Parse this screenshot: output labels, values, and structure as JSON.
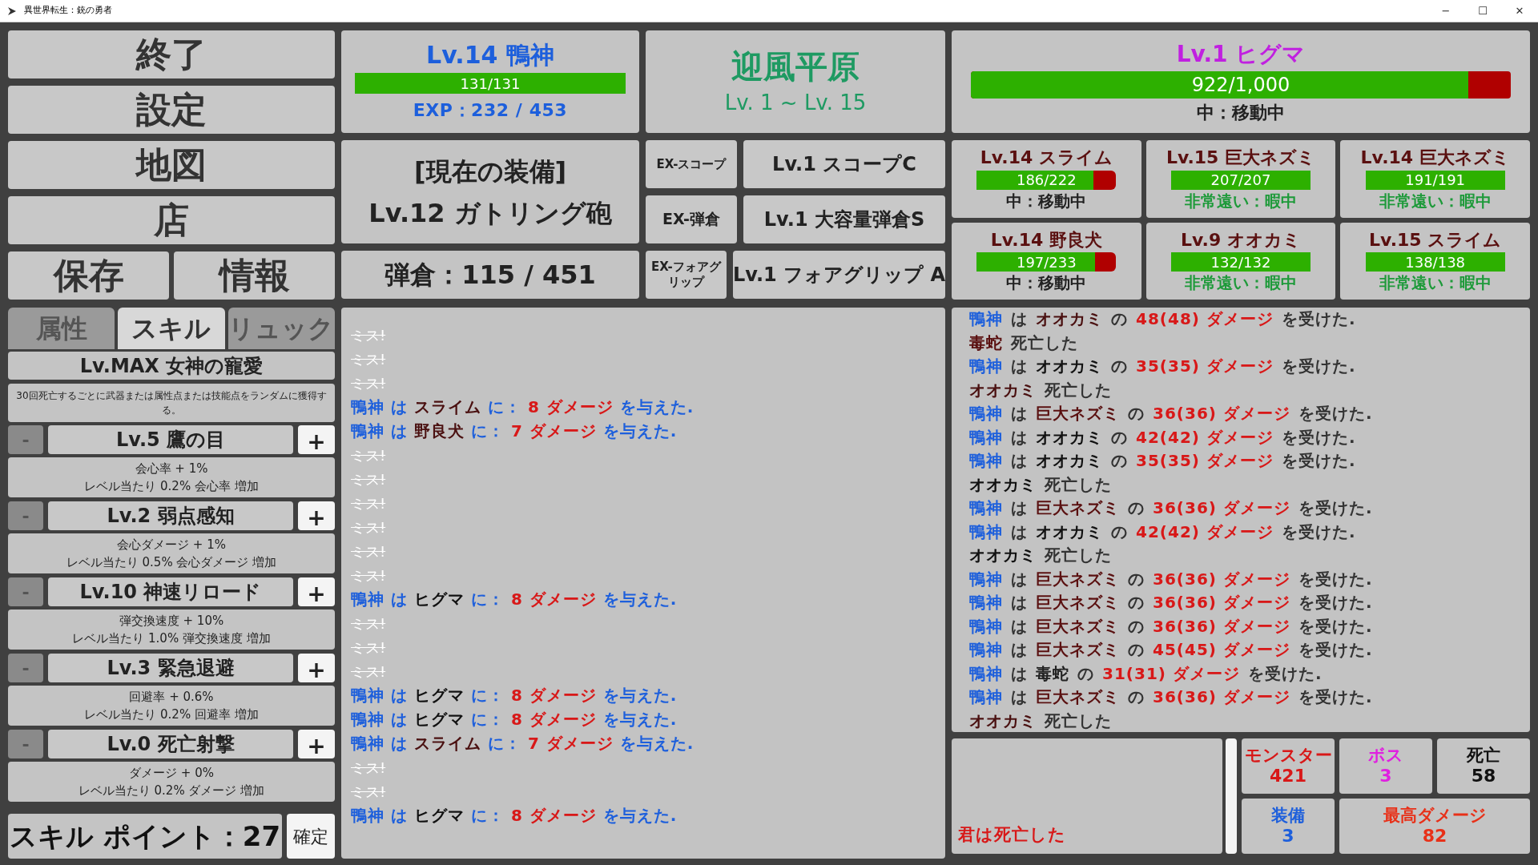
{
  "window": {
    "title": "異世界転生：銃の勇者",
    "controls": [
      "−",
      "☐",
      "✕"
    ]
  },
  "menu": {
    "top": [
      "終了",
      "設定",
      "地図",
      "店"
    ],
    "bottom": [
      "保存",
      "情報"
    ]
  },
  "player": {
    "name": "Lv.14 鴨神",
    "hp": "131/131",
    "level": 1,
    "exp": "EXP：232 / 453"
  },
  "equipment": {
    "heading": "[現在の装備]",
    "weapon": "Lv.12 ガトリング砲",
    "ammo": "弾倉：115 / 451",
    "slots": [
      {
        "slot": "EX-スコープ",
        "item": "Lv.1 スコープC"
      },
      {
        "slot": "EX-弾倉",
        "item": "Lv.1 大容量弾倉S"
      },
      {
        "slot": "EX-フォアグリップ",
        "item": "Lv.1 フォアグリップ A"
      }
    ]
  },
  "area": {
    "name": "迎風平原",
    "range": "Lv. 1 ~ Lv. 15"
  },
  "boss": {
    "name": "Lv.1 ヒグマ",
    "hp": "922/1,000",
    "level": 0.922,
    "status": "中：移動中",
    "kind": "near"
  },
  "monsters": [
    {
      "name": "Lv.14 スライム",
      "hp": "186/222",
      "level": 0.84,
      "status": "中：移動中",
      "kind": "near"
    },
    {
      "name": "Lv.15 巨大ネズミ",
      "hp": "207/207",
      "level": 1,
      "status": "非常遠い：暇中",
      "kind": "far"
    },
    {
      "name": "Lv.14 巨大ネズミ",
      "hp": "191/191",
      "level": 1,
      "status": "非常遠い：暇中",
      "kind": "far"
    },
    {
      "name": "Lv.14 野良犬",
      "hp": "197/233",
      "level": 0.85,
      "status": "中：移動中",
      "kind": "near"
    },
    {
      "name": "Lv.9 オオカミ",
      "hp": "132/132",
      "level": 1,
      "status": "非常遠い：暇中",
      "kind": "far"
    },
    {
      "name": "Lv.15 スライム",
      "hp": "138/138",
      "level": 1,
      "status": "非常遠い：暇中",
      "kind": "far"
    }
  ],
  "tabs": [
    {
      "label": "属性",
      "selected": false
    },
    {
      "label": "スキル",
      "selected": true
    },
    {
      "label": "リュック",
      "selected": false
    }
  ],
  "passive": {
    "name": "Lv.MAX 女神の寵愛",
    "description": "30回死亡するごとに武器または属性点または技能点をランダムに獲得する。"
  },
  "skills": [
    {
      "name": "Lv.5 鷹の目",
      "effect": "会心率 + 1%",
      "per_level": "レベル当たり 0.2% 会心率 増加"
    },
    {
      "name": "Lv.2 弱点感知",
      "effect": "会心ダメージ + 1%",
      "per_level": "レベル当たり 0.5% 会心ダメージ 増加"
    },
    {
      "name": "Lv.10 神速リロード",
      "effect": "弾交換速度 + 10%",
      "per_level": "レベル当たり 1.0% 弾交換速度 増加"
    },
    {
      "name": "Lv.3 緊急退避",
      "effect": "回避率 + 0.6%",
      "per_level": "レベル当たり 0.2% 回避率 増加"
    },
    {
      "name": "Lv.0 死亡射撃",
      "effect": "ダメージ + 0%",
      "per_level": "レベル当たり 0.2% ダメージ 増加"
    }
  ],
  "skill_buttons": {
    "minus": "-",
    "plus": "+"
  },
  "skill_points": {
    "label": "スキル ポイント：27",
    "confirm": "確定"
  },
  "attack_log": [
    {
      "kind": "miss",
      "text": "ミス!"
    },
    {
      "kind": "miss",
      "text": "ミス!"
    },
    {
      "kind": "miss",
      "text": "ミス!"
    },
    {
      "kind": "hit",
      "parts": [
        {
          "text": "鴨神 は",
          "color": "#1d5fdc"
        },
        {
          "text": "スライム",
          "color": "#4a1010"
        },
        {
          "text": "に：",
          "color": "#1d5fdc"
        },
        {
          "text": "8 ダメージ",
          "color": "#d81818"
        },
        {
          "text": "を与えた.",
          "color": "#1d5fdc"
        }
      ]
    },
    {
      "kind": "hit",
      "parts": [
        {
          "text": "鴨神 は",
          "color": "#1d5fdc"
        },
        {
          "text": "野良犬",
          "color": "#4a1010"
        },
        {
          "text": "に：",
          "color": "#1d5fdc"
        },
        {
          "text": "7 ダメージ",
          "color": "#d81818"
        },
        {
          "text": "を与えた.",
          "color": "#1d5fdc"
        }
      ]
    },
    {
      "kind": "miss",
      "text": "ミス!"
    },
    {
      "kind": "miss",
      "text": "ミス!"
    },
    {
      "kind": "miss",
      "text": "ミス!"
    },
    {
      "kind": "miss",
      "text": "ミス!"
    },
    {
      "kind": "miss",
      "text": "ミス!"
    },
    {
      "kind": "miss",
      "text": "ミス!"
    },
    {
      "kind": "hit",
      "parts": [
        {
          "text": "鴨神 は",
          "color": "#1d5fdc"
        },
        {
          "text": "ヒグマ",
          "color": "#111111"
        },
        {
          "text": "に：",
          "color": "#1d5fdc"
        },
        {
          "text": "8 ダメージ",
          "color": "#d81818"
        },
        {
          "text": "を与えた.",
          "color": "#1d5fdc"
        }
      ]
    },
    {
      "kind": "miss",
      "text": "ミス!"
    },
    {
      "kind": "miss",
      "text": "ミス!"
    },
    {
      "kind": "miss",
      "text": "ミス!"
    },
    {
      "kind": "hit",
      "parts": [
        {
          "text": "鴨神 は",
          "color": "#1d5fdc"
        },
        {
          "text": "ヒグマ",
          "color": "#111111"
        },
        {
          "text": "に：",
          "color": "#1d5fdc"
        },
        {
          "text": "8 ダメージ",
          "color": "#d81818"
        },
        {
          "text": "を与えた.",
          "color": "#1d5fdc"
        }
      ]
    },
    {
      "kind": "hit",
      "parts": [
        {
          "text": "鴨神 は",
          "color": "#1d5fdc"
        },
        {
          "text": "ヒグマ",
          "color": "#111111"
        },
        {
          "text": "に：",
          "color": "#1d5fdc"
        },
        {
          "text": "8 ダメージ",
          "color": "#d81818"
        },
        {
          "text": "を与えた.",
          "color": "#1d5fdc"
        }
      ]
    },
    {
      "kind": "hit",
      "parts": [
        {
          "text": "鴨神 は",
          "color": "#1d5fdc"
        },
        {
          "text": "スライム",
          "color": "#4a1010"
        },
        {
          "text": "に：",
          "color": "#1d5fdc"
        },
        {
          "text": "7 ダメージ",
          "color": "#d81818"
        },
        {
          "text": "を与えた.",
          "color": "#1d5fdc"
        }
      ]
    },
    {
      "kind": "miss",
      "text": "ミス!"
    },
    {
      "kind": "miss",
      "text": "ミス!"
    },
    {
      "kind": "hit",
      "parts": [
        {
          "text": "鴨神 は",
          "color": "#1d5fdc"
        },
        {
          "text": "ヒグマ",
          "color": "#111111"
        },
        {
          "text": "に：",
          "color": "#1d5fdc"
        },
        {
          "text": "8 ダメージ",
          "color": "#d81818"
        },
        {
          "text": "を与えた.",
          "color": "#1d5fdc"
        }
      ]
    }
  ],
  "damage_log": [
    {
      "parts": [
        {
          "text": "鴨神",
          "color": "#1d5fdc"
        },
        {
          "text": "は",
          "color": "#333333"
        },
        {
          "text": "オオカミ",
          "color": "#4a1010"
        },
        {
          "text": "の",
          "color": "#333333"
        },
        {
          "text": "48(48) ダメージ",
          "color": "#d81818"
        },
        {
          "text": "を受けた.",
          "color": "#333333"
        }
      ]
    },
    {
      "parts": [
        {
          "text": "毒蛇",
          "color": "#5a1010"
        },
        {
          "text": "死亡した",
          "color": "#333333"
        }
      ]
    },
    {
      "parts": [
        {
          "text": "鴨神",
          "color": "#1d5fdc"
        },
        {
          "text": "は",
          "color": "#333333"
        },
        {
          "text": "オオカミ",
          "color": "#111111"
        },
        {
          "text": "の",
          "color": "#333333"
        },
        {
          "text": "35(35) ダメージ",
          "color": "#d81818"
        },
        {
          "text": "を受けた.",
          "color": "#333333"
        }
      ]
    },
    {
      "parts": [
        {
          "text": "オオカミ",
          "color": "#4a1010"
        },
        {
          "text": "死亡した",
          "color": "#333333"
        }
      ]
    },
    {
      "parts": [
        {
          "text": "鴨神",
          "color": "#1d5fdc"
        },
        {
          "text": "は",
          "color": "#333333"
        },
        {
          "text": "巨大ネズミ",
          "color": "#5a1010"
        },
        {
          "text": "の",
          "color": "#333333"
        },
        {
          "text": "36(36) ダメージ",
          "color": "#d81818"
        },
        {
          "text": "を受けた.",
          "color": "#333333"
        }
      ]
    },
    {
      "parts": [
        {
          "text": "鴨神",
          "color": "#1d5fdc"
        },
        {
          "text": "は",
          "color": "#333333"
        },
        {
          "text": "オオカミ",
          "color": "#111111"
        },
        {
          "text": "の",
          "color": "#333333"
        },
        {
          "text": "42(42) ダメージ",
          "color": "#d81818"
        },
        {
          "text": "を受けた.",
          "color": "#333333"
        }
      ]
    },
    {
      "parts": [
        {
          "text": "鴨神",
          "color": "#1d5fdc"
        },
        {
          "text": "は",
          "color": "#333333"
        },
        {
          "text": "オオカミ",
          "color": "#111111"
        },
        {
          "text": "の",
          "color": "#333333"
        },
        {
          "text": "35(35) ダメージ",
          "color": "#d81818"
        },
        {
          "text": "を受けた.",
          "color": "#333333"
        }
      ]
    },
    {
      "parts": [
        {
          "text": "オオカミ",
          "color": "#111111"
        },
        {
          "text": "死亡した",
          "color": "#333333"
        }
      ]
    },
    {
      "parts": [
        {
          "text": "鴨神",
          "color": "#1d5fdc"
        },
        {
          "text": "は",
          "color": "#333333"
        },
        {
          "text": "巨大ネズミ",
          "color": "#5a1010"
        },
        {
          "text": "の",
          "color": "#333333"
        },
        {
          "text": "36(36) ダメージ",
          "color": "#d81818"
        },
        {
          "text": "を受けた.",
          "color": "#333333"
        }
      ]
    },
    {
      "parts": [
        {
          "text": "鴨神",
          "color": "#1d5fdc"
        },
        {
          "text": "は",
          "color": "#333333"
        },
        {
          "text": "オオカミ",
          "color": "#111111"
        },
        {
          "text": "の",
          "color": "#333333"
        },
        {
          "text": "42(42) ダメージ",
          "color": "#d81818"
        },
        {
          "text": "を受けた.",
          "color": "#333333"
        }
      ]
    },
    {
      "parts": [
        {
          "text": "オオカミ",
          "color": "#111111"
        },
        {
          "text": "死亡した",
          "color": "#333333"
        }
      ]
    },
    {
      "parts": [
        {
          "text": "鴨神",
          "color": "#1d5fdc"
        },
        {
          "text": "は",
          "color": "#333333"
        },
        {
          "text": "巨大ネズミ",
          "color": "#5a1010"
        },
        {
          "text": "の",
          "color": "#333333"
        },
        {
          "text": "36(36) ダメージ",
          "color": "#d81818"
        },
        {
          "text": "を受けた.",
          "color": "#333333"
        }
      ]
    },
    {
      "parts": [
        {
          "text": "鴨神",
          "color": "#1d5fdc"
        },
        {
          "text": "は",
          "color": "#333333"
        },
        {
          "text": "巨大ネズミ",
          "color": "#5a1010"
        },
        {
          "text": "の",
          "color": "#333333"
        },
        {
          "text": "36(36) ダメージ",
          "color": "#d81818"
        },
        {
          "text": "を受けた.",
          "color": "#333333"
        }
      ]
    },
    {
      "parts": [
        {
          "text": "鴨神",
          "color": "#1d5fdc"
        },
        {
          "text": "は",
          "color": "#333333"
        },
        {
          "text": "巨大ネズミ",
          "color": "#5a1010"
        },
        {
          "text": "の",
          "color": "#333333"
        },
        {
          "text": "36(36) ダメージ",
          "color": "#d81818"
        },
        {
          "text": "を受けた.",
          "color": "#333333"
        }
      ]
    },
    {
      "parts": [
        {
          "text": "鴨神",
          "color": "#1d5fdc"
        },
        {
          "text": "は",
          "color": "#333333"
        },
        {
          "text": "巨大ネズミ",
          "color": "#5a1010"
        },
        {
          "text": "の",
          "color": "#333333"
        },
        {
          "text": "45(45) ダメージ",
          "color": "#d81818"
        },
        {
          "text": "を受けた.",
          "color": "#333333"
        }
      ]
    },
    {
      "parts": [
        {
          "text": "鴨神",
          "color": "#1d5fdc"
        },
        {
          "text": "は",
          "color": "#333333"
        },
        {
          "text": "毒蛇",
          "color": "#222222"
        },
        {
          "text": "の",
          "color": "#333333"
        },
        {
          "text": "31(31) ダメージ",
          "color": "#d81818"
        },
        {
          "text": "を受けた.",
          "color": "#333333"
        }
      ]
    },
    {
      "parts": [
        {
          "text": "鴨神",
          "color": "#1d5fdc"
        },
        {
          "text": "は",
          "color": "#333333"
        },
        {
          "text": "巨大ネズミ",
          "color": "#5a1010"
        },
        {
          "text": "の",
          "color": "#333333"
        },
        {
          "text": "36(36) ダメージ",
          "color": "#d81818"
        },
        {
          "text": "を受けた.",
          "color": "#333333"
        }
      ]
    },
    {
      "parts": [
        {
          "text": "オオカミ",
          "color": "#4a1010"
        },
        {
          "text": "死亡した",
          "color": "#333333"
        }
      ]
    }
  ],
  "message": "君は死亡した",
  "stats": [
    {
      "label": "モンスター",
      "value": "421",
      "color": "#d81818"
    },
    {
      "label": "ボス",
      "value": "3",
      "color": "#e020e0"
    },
    {
      "label": "死亡",
      "value": "58",
      "color": "#111111"
    },
    {
      "label": "装備",
      "value": "3",
      "color": "#1d5fdc"
    },
    {
      "label": "最高ダメージ",
      "value": "82",
      "color": "#e83018"
    }
  ]
}
